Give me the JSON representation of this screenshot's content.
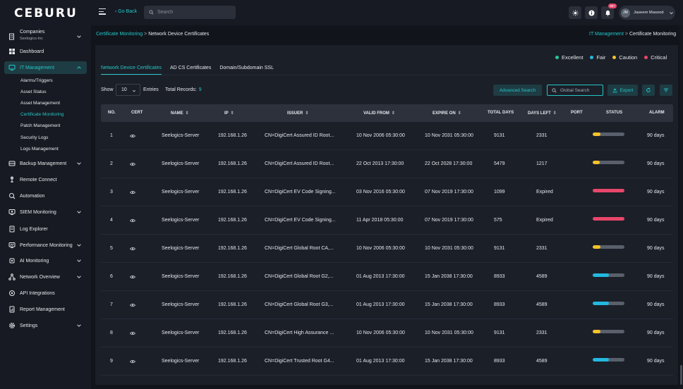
{
  "brand": {
    "logo": "CEBURU",
    "accent": "#24c6c8"
  },
  "topbar": {
    "go_back": "‹ Go Back",
    "search_placeholder": "Search",
    "notification_count": "99+",
    "user_initials": "JM",
    "user_name": "Jaseem Masood"
  },
  "sidebar": {
    "company_label": "Companies",
    "company_name": "Seelogics-Inc",
    "items": [
      {
        "label": "Dashboard",
        "icon": "dashboard-icon"
      },
      {
        "label": "IT Management",
        "icon": "it-management-icon"
      },
      {
        "label": "Backup Management",
        "icon": "backup-icon"
      },
      {
        "label": "Remote Connect",
        "icon": "remote-icon"
      },
      {
        "label": "Automation",
        "icon": "automation-icon"
      },
      {
        "label": "SIEM Monitoring",
        "icon": "siem-icon"
      },
      {
        "label": "Log Explorer",
        "icon": "log-icon"
      },
      {
        "label": "Performance Monitoring",
        "icon": "performance-icon"
      },
      {
        "label": "AI Monitoring",
        "icon": "ai-icon"
      },
      {
        "label": "Network Overview",
        "icon": "network-icon"
      },
      {
        "label": "API Integrations",
        "icon": "api-icon"
      },
      {
        "label": "Report Management",
        "icon": "report-icon"
      },
      {
        "label": "Settings",
        "icon": "settings-icon"
      }
    ],
    "sub_items": [
      "Alarms/Triggers",
      "Asset Status",
      "Asset Management",
      "Certificate Monitoring",
      "Patch Management",
      "Security Logs",
      "Logs Management"
    ]
  },
  "breadcrumb": {
    "left_1": "Certificate Monitoring",
    "left_2": "Network Device Certificates",
    "right_1": "IT Management",
    "right_2": "Certificate Monitoring"
  },
  "legend": [
    {
      "label": "Excellent",
      "color": "#24c6a0"
    },
    {
      "label": "Fair",
      "color": "#23b8e0"
    },
    {
      "label": "Caution",
      "color": "#f5c22b"
    },
    {
      "label": "Critical",
      "color": "#e8466b"
    }
  ],
  "tabs": [
    "Network Device Certificates",
    "AD CS Certificates",
    "Domain/Subdomain SSL"
  ],
  "toolbar": {
    "show_label": "Show",
    "entries_value": "10",
    "entries_label": "Entries",
    "total_label": "Total Records:",
    "total_value": "9",
    "advanced_search": "Advanced Search",
    "global_search_placeholder": "Global Search",
    "export": "Export"
  },
  "table": {
    "headers": [
      "NO.",
      "CERT",
      "NAME",
      "IP",
      "ISSUER",
      "VALID FROM",
      "EXPIRE ON",
      "TOTAL DAYS",
      "DAYS LEFT",
      "PORT",
      "STATUS",
      "ALARM"
    ],
    "rows": [
      {
        "no": "1",
        "name": "Seelogics-Server",
        "ip": "192.168.1.26",
        "issuer": "CN=DigiCert Assured ID Root...",
        "valid_from": "10 Nov 2006 05:30:00",
        "expire_on": "10 Nov 2031 05:30:00",
        "total_days": "9131",
        "days_left": "2331",
        "port": "",
        "status_fill": 0.25,
        "status_color": "#f5c22b",
        "alarm": "90 days"
      },
      {
        "no": "2",
        "name": "Seelogics-Server",
        "ip": "192.168.1.26",
        "issuer": "CN=DigiCert Assured ID Root...",
        "valid_from": "22 Oct 2013 17:30:00",
        "expire_on": "22 Oct 2028 17:30:00",
        "total_days": "5479",
        "days_left": "1217",
        "port": "",
        "status_fill": 0.22,
        "status_color": "#f5c22b",
        "alarm": "90 days"
      },
      {
        "no": "3",
        "name": "Seelogics-Server",
        "ip": "192.168.1.26",
        "issuer": "CN=DigiCert EV Code Signing...",
        "valid_from": "03 Nov 2016 05:30:00",
        "expire_on": "07 Nov 2019 17:30:00",
        "total_days": "1099",
        "days_left": "Expired",
        "port": "",
        "status_fill": 1.0,
        "status_color": "#e8466b",
        "alarm": "90 days"
      },
      {
        "no": "4",
        "name": "Seelogics-Server",
        "ip": "192.168.1.26",
        "issuer": "CN=DigiCert EV Code Signing...",
        "valid_from": "11 Apr 2018 05:30:00",
        "expire_on": "07 Nov 2019 17:30:00",
        "total_days": "575",
        "days_left": "Expired",
        "port": "",
        "status_fill": 1.0,
        "status_color": "#e8466b",
        "alarm": "90 days"
      },
      {
        "no": "5",
        "name": "Seelogics-Server",
        "ip": "192.168.1.26",
        "issuer": "CN=DigiCert Global Root CA,...",
        "valid_from": "10 Nov 2006 05:30:00",
        "expire_on": "10 Nov 2031 05:30:00",
        "total_days": "9131",
        "days_left": "2331",
        "port": "",
        "status_fill": 0.25,
        "status_color": "#f5c22b",
        "alarm": "90 days"
      },
      {
        "no": "6",
        "name": "Seelogics-Server",
        "ip": "192.168.1.26",
        "issuer": "CN=DigiCert Global Root G2,...",
        "valid_from": "01 Aug 2013 17:30:00",
        "expire_on": "15 Jan 2038 17:30:00",
        "total_days": "8933",
        "days_left": "4589",
        "port": "",
        "status_fill": 0.51,
        "status_color": "#23b8e0",
        "alarm": "90 days"
      },
      {
        "no": "7",
        "name": "Seelogics-Server",
        "ip": "192.168.1.26",
        "issuer": "CN=DigiCert Global Root G3,...",
        "valid_from": "01 Aug 2013 17:30:00",
        "expire_on": "15 Jan 2038 17:30:00",
        "total_days": "8933",
        "days_left": "4589",
        "port": "",
        "status_fill": 0.51,
        "status_color": "#23b8e0",
        "alarm": "90 days"
      },
      {
        "no": "8",
        "name": "Seelogics-Server",
        "ip": "192.168.1.26",
        "issuer": "CN=DigiCert High Assurance ...",
        "valid_from": "10 Nov 2006 05:30:00",
        "expire_on": "10 Nov 2031 05:30:00",
        "total_days": "9131",
        "days_left": "2331",
        "port": "",
        "status_fill": 0.25,
        "status_color": "#f5c22b",
        "alarm": "90 days"
      },
      {
        "no": "9",
        "name": "Seelogics-Server",
        "ip": "192.168.1.26",
        "issuer": "CN=DigiCert Trusted Root G4...",
        "valid_from": "01 Aug 2013 17:30:00",
        "expire_on": "15 Jan 2038 17:30:00",
        "total_days": "8933",
        "days_left": "4589",
        "port": "",
        "status_fill": 0.51,
        "status_color": "#23b8e0",
        "alarm": "90 days"
      }
    ]
  }
}
